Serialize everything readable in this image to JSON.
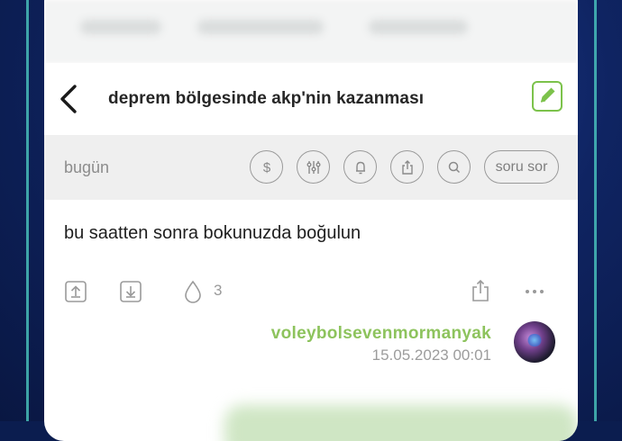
{
  "topic": {
    "title": "deprem bölgesinde akp'nin kazanması"
  },
  "toolbar": {
    "day_label": "bugün",
    "ask_label": "soru sor"
  },
  "entry": {
    "text": "bu saatten sonra bokunuzda boğulun",
    "favorite_count": "3",
    "author": "voleybolsevenmormanyak",
    "date": "15.05.2023 00:01"
  },
  "colors": {
    "accent_green": "#7cc24b",
    "author_green": "#8dc35d",
    "toolbar_bg": "#efefef",
    "frame_teal": "#4fd1c5"
  },
  "icons": {
    "back": "chevron-left-icon",
    "edit": "pencil-icon",
    "toolbar": [
      "dollar-icon",
      "sliders-icon",
      "bell-icon",
      "share-icon",
      "search-icon"
    ],
    "actions": [
      "upvote-icon",
      "downvote-icon",
      "drop-icon",
      "share-icon",
      "more-icon"
    ]
  }
}
